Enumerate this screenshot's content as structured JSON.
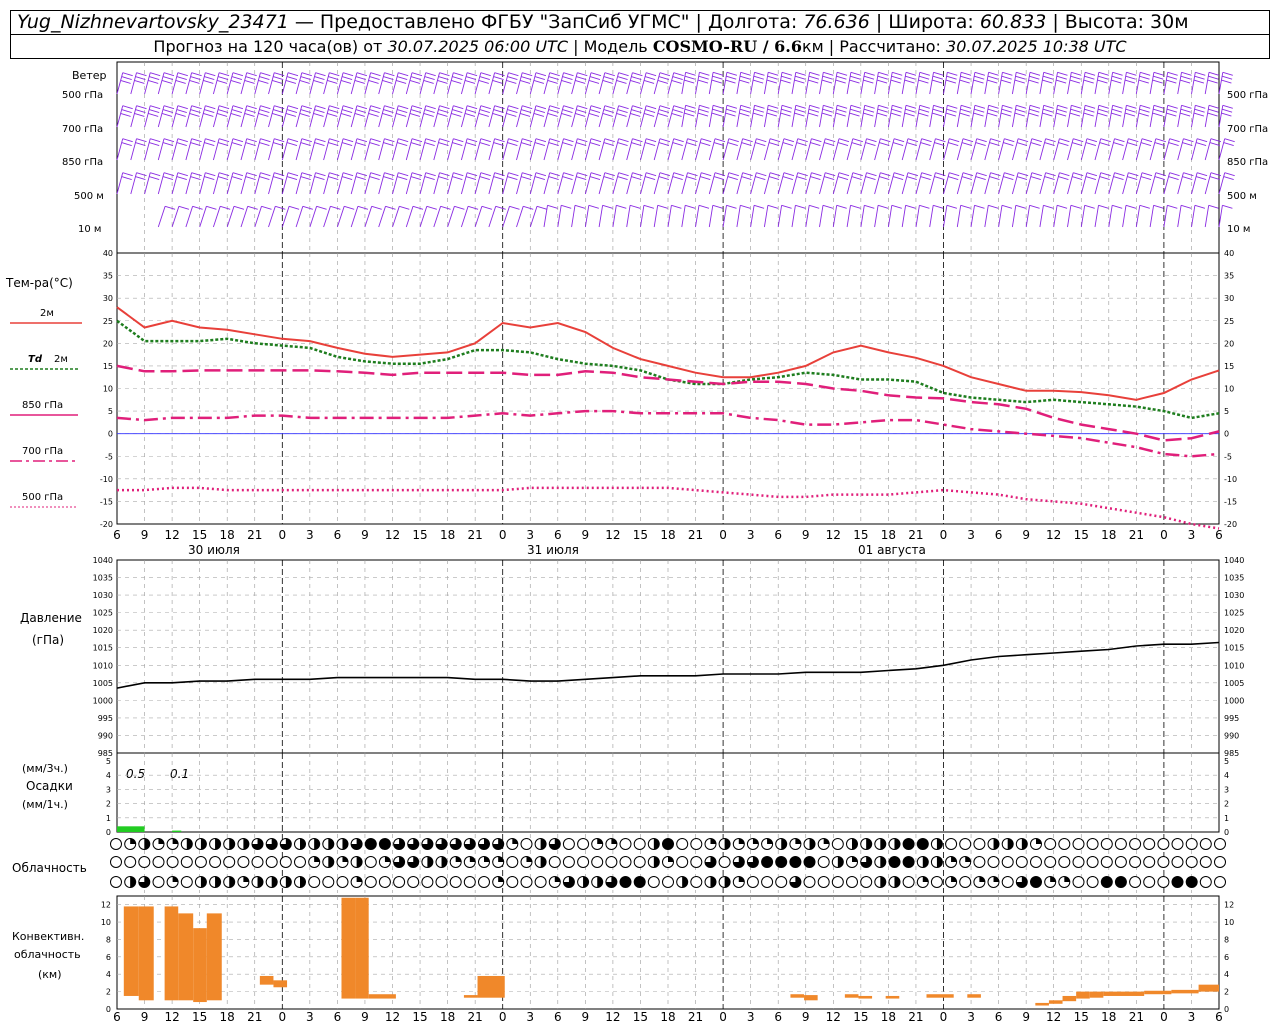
{
  "header": {
    "station": "Yug_Nizhnevartovsky_23471",
    "provider": " — Предоставлено ФГБУ \"ЗапСиб УГМС\" | Долгота: ",
    "lon": "76.636",
    "lat_label": " | Широта: ",
    "lat": "60.833",
    "alt": " | Высота: 30м",
    "forecast_pre": "Прогноз на 120 часа(ов) от ",
    "forecast_time": "30.07.2025 06:00 UTC",
    "model_pre": " | Модель ",
    "model": "COSMO-RU / 6.6",
    "model_unit": "км | Рассчитано: ",
    "calc_time": "30.07.2025 10:38 UTC"
  },
  "wind": {
    "title": "Ветер",
    "levels": [
      "500 гПа",
      "700 гПа",
      "850 гПа",
      "500 м",
      "10 м"
    ],
    "color": "#8a2be2"
  },
  "labels": {
    "temp_title": "Тем-ра(°C)",
    "t2m": "2м",
    "td_pre": "Td",
    "td_post": "2м",
    "p850": "850 гПа",
    "p700": "700 гПа",
    "p500": "500 гПа",
    "pressure_title": "Давление",
    "pressure_unit": "(гПа)",
    "precip_unit3": "(мм/3ч.)",
    "precip_title": "Осадки",
    "precip_unit1": "(мм/1ч.)",
    "cloud_title": "Облачность",
    "conv1": "Конвективн.",
    "conv2": "облачность",
    "conv3": "(км)",
    "precip_val1": "0.5",
    "precip_val2": "0.1"
  },
  "time_axis": {
    "hour_labels": [
      "6",
      "9",
      "12",
      "15",
      "18",
      "21",
      "0",
      "3",
      "6",
      "9",
      "12",
      "15",
      "18",
      "21",
      "0",
      "3",
      "6",
      "9",
      "12",
      "15",
      "18",
      "21",
      "0",
      "3",
      "6",
      "9",
      "12"
    ],
    "dates": [
      "30 июля",
      "31 июля",
      "01 августа"
    ]
  },
  "chart_data": [
    {
      "type": "line",
      "title": "Тем-ра(°C)",
      "ylim": [
        -20,
        40
      ],
      "yticks": [
        -20,
        -15,
        -10,
        -5,
        0,
        5,
        10,
        15,
        20,
        25,
        30,
        35,
        40
      ],
      "x_hours": [
        0,
        3,
        6,
        9,
        12,
        15,
        18,
        21,
        24,
        27,
        30,
        33,
        36,
        39,
        42,
        45,
        48,
        51,
        54,
        57,
        60,
        63,
        66,
        69,
        72,
        75,
        78,
        81,
        84,
        87,
        90,
        93,
        96,
        99,
        102,
        105,
        108,
        111,
        114,
        117,
        120
      ],
      "series": [
        {
          "name": "2м",
          "color": "#e8403a",
          "dash": "",
          "values": [
            28,
            23.5,
            25,
            23.5,
            23,
            22,
            21,
            20.5,
            19,
            17.7,
            17,
            17.5,
            18,
            20,
            24.5,
            23.5,
            24.5,
            22.5,
            19,
            16.5,
            15,
            13.5,
            12.5,
            12.5,
            13.5,
            15,
            18,
            19.5,
            18,
            16.8,
            15,
            12.5,
            11,
            9.5,
            9.5,
            9.2,
            8.5,
            7.5,
            9,
            12,
            14
          ]
        },
        {
          "name": "Td 2м",
          "color": "#1e7d1e",
          "dash": "3,2",
          "values": [
            25,
            20.5,
            20.5,
            20.5,
            21,
            20,
            19.5,
            19,
            17,
            16,
            15.5,
            15.5,
            16.5,
            18.5,
            18.5,
            18,
            16.5,
            15.5,
            15,
            14,
            12,
            11,
            11,
            12,
            12.5,
            13.5,
            13,
            12,
            12,
            11.5,
            9,
            8,
            7.5,
            7,
            7.5,
            7,
            6.5,
            6,
            5,
            3.5,
            4.5
          ]
        },
        {
          "name": "850 гПа",
          "color": "#e01f7a",
          "dash": "16,6",
          "values": [
            15,
            13.8,
            13.8,
            14,
            14,
            14,
            14,
            14,
            13.8,
            13.5,
            13,
            13.5,
            13.5,
            13.5,
            13.5,
            13,
            13,
            13.8,
            13.5,
            12.5,
            12,
            11.5,
            11,
            11.5,
            11.5,
            11,
            10,
            9.5,
            8.5,
            8,
            7.8,
            7,
            6.5,
            5.5,
            3.5,
            2,
            1,
            0,
            -1.5,
            -1,
            0.5
          ]
        },
        {
          "name": "700 гПа",
          "color": "#e01f7a",
          "dash": "14,5,3,5",
          "values": [
            3.5,
            3,
            3.5,
            3.5,
            3.5,
            4,
            4,
            3.5,
            3.5,
            3.5,
            3.5,
            3.5,
            3.5,
            4,
            4.5,
            4,
            4.5,
            5,
            5,
            4.5,
            4.5,
            4.5,
            4.5,
            3.5,
            3,
            2,
            2,
            2.5,
            3,
            3,
            2,
            1,
            0.5,
            0,
            -0.5,
            -1,
            -2,
            -3,
            -4.5,
            -5,
            -4.5
          ]
        },
        {
          "name": "500 гПа",
          "color": "#e01f7a",
          "dash": "2,3",
          "values": [
            -12.5,
            -12.5,
            -12,
            -12,
            -12.5,
            -12.5,
            -12.5,
            -12.5,
            -12.5,
            -12.5,
            -12.5,
            -12.5,
            -12.5,
            -12.5,
            -12.5,
            -12,
            -12,
            -12,
            -12,
            -12,
            -12,
            -12.5,
            -13,
            -13.5,
            -14,
            -14,
            -13.5,
            -13.5,
            -13.5,
            -13,
            -12.5,
            -13,
            -13.5,
            -14.5,
            -15,
            -15.5,
            -16.5,
            -17.5,
            -18.5,
            -20,
            -21
          ]
        }
      ]
    },
    {
      "type": "line",
      "title": "Давление (гПа)",
      "ylim": [
        985,
        1040
      ],
      "yticks": [
        985,
        990,
        995,
        1000,
        1005,
        1010,
        1015,
        1020,
        1025,
        1030,
        1035,
        1040
      ],
      "x_hours": [
        0,
        3,
        6,
        9,
        12,
        15,
        18,
        21,
        24,
        27,
        30,
        33,
        36,
        39,
        42,
        45,
        48,
        51,
        54,
        57,
        60,
        63,
        66,
        69,
        72,
        75,
        78,
        81,
        84,
        87,
        90,
        93,
        96,
        99,
        102,
        105,
        108,
        111,
        114,
        117,
        120
      ],
      "series": [
        {
          "name": "Давление",
          "color": "#000000",
          "values": [
            1003.5,
            1005,
            1005,
            1005.5,
            1005.5,
            1006,
            1006,
            1006,
            1006.5,
            1006.5,
            1006.5,
            1006.5,
            1006.5,
            1006,
            1006,
            1005.5,
            1005.5,
            1006,
            1006.5,
            1007,
            1007,
            1007,
            1007.5,
            1007.5,
            1007.5,
            1008,
            1008,
            1008,
            1008.5,
            1009,
            1010,
            1011.5,
            1012.5,
            1013,
            1013.5,
            1014,
            1014.5,
            1015.5,
            1016,
            1016,
            1016.5
          ]
        }
      ]
    },
    {
      "type": "bar",
      "title": "Осадки",
      "ylim": [
        0,
        5
      ],
      "yticks": [
        0,
        1,
        2,
        3,
        4,
        5
      ],
      "bars": [
        {
          "from_h": 0,
          "to_h": 3,
          "value": 0.4
        },
        {
          "from_h": 6,
          "to_h": 7,
          "value": 0.1
        }
      ]
    },
    {
      "type": "bar",
      "title": "Конвективн. облачность (км)",
      "ylim": [
        0,
        13
      ],
      "yticks": [
        0,
        2,
        4,
        6,
        8,
        10,
        12
      ],
      "bars": [
        {
          "from_h": 0.5,
          "to_h": 1.6,
          "base": 1.5,
          "top": 11.8
        },
        {
          "from_h": 1.6,
          "to_h": 2.7,
          "base": 1.0,
          "top": 11.8
        },
        {
          "from_h": 3.5,
          "to_h": 4.5,
          "base": 1.0,
          "top": 11.8
        },
        {
          "from_h": 4.5,
          "to_h": 5.6,
          "base": 1.0,
          "top": 11.0
        },
        {
          "from_h": 5.6,
          "to_h": 6.6,
          "base": 0.8,
          "top": 9.3
        },
        {
          "from_h": 6.6,
          "to_h": 7.7,
          "base": 1.0,
          "top": 11.0
        },
        {
          "from_h": 10.5,
          "to_h": 11.5,
          "base": 2.8,
          "top": 3.8
        },
        {
          "from_h": 11.5,
          "to_h": 12.5,
          "base": 2.5,
          "top": 3.3
        },
        {
          "from_h": 16.5,
          "to_h": 17.5,
          "base": 1.2,
          "top": 12.8
        },
        {
          "from_h": 17.5,
          "to_h": 18.5,
          "base": 1.2,
          "top": 12.8
        },
        {
          "from_h": 18.5,
          "to_h": 20.5,
          "base": 1.2,
          "top": 1.7
        },
        {
          "from_h": 25.5,
          "to_h": 26.5,
          "base": 1.3,
          "top": 1.6
        },
        {
          "from_h": 26.5,
          "to_h": 28.5,
          "base": 1.3,
          "top": 3.8
        },
        {
          "from_h": 49.5,
          "to_h": 50.5,
          "base": 1.3,
          "top": 1.7
        },
        {
          "from_h": 50.5,
          "to_h": 51.5,
          "base": 1.0,
          "top": 1.6
        },
        {
          "from_h": 53.5,
          "to_h": 54.5,
          "base": 1.3,
          "top": 1.7
        },
        {
          "from_h": 54.5,
          "to_h": 55.5,
          "base": 1.2,
          "top": 1.5
        },
        {
          "from_h": 56.5,
          "to_h": 57.5,
          "base": 1.2,
          "top": 1.5
        },
        {
          "from_h": 59.5,
          "to_h": 61.5,
          "base": 1.3,
          "top": 1.7
        },
        {
          "from_h": 62.5,
          "to_h": 63.5,
          "base": 1.3,
          "top": 1.7
        },
        {
          "from_h": 67.5,
          "to_h": 68.5,
          "base": 0.4,
          "top": 0.7
        },
        {
          "from_h": 68.5,
          "to_h": 69.5,
          "base": 0.6,
          "top": 1.0
        },
        {
          "from_h": 69.5,
          "to_h": 70.5,
          "base": 0.9,
          "top": 1.5
        },
        {
          "from_h": 70.5,
          "to_h": 71.5,
          "base": 1.2,
          "top": 2.0
        },
        {
          "from_h": 71.5,
          "to_h": 72.5,
          "base": 1.3,
          "top": 2.0
        },
        {
          "from_h": 72.5,
          "to_h": 75.5,
          "base": 1.5,
          "top": 2.0
        },
        {
          "from_h": 75.5,
          "to_h": 77.5,
          "base": 1.7,
          "top": 2.1
        },
        {
          "from_h": 77.5,
          "to_h": 79.5,
          "base": 1.8,
          "top": 2.2
        },
        {
          "from_h": 79.5,
          "to_h": 81.0,
          "base": 2.0,
          "top": 2.8
        }
      ],
      "color": "#f0882a"
    }
  ],
  "cloud_rows": {
    "values": [
      "012112222233322223443333333310230011002400121112121022224420002221000000000000000000000000000000000000000000000000000000000",
      "000000000000001212013322111101200000002100303344440213244221100000000000000000000000000000000000000000000000000000000000044",
      "023010222122220001000000000100013223440020221000300000220101011034110044000440000041442000004444444444000000002100141131314"
    ]
  }
}
